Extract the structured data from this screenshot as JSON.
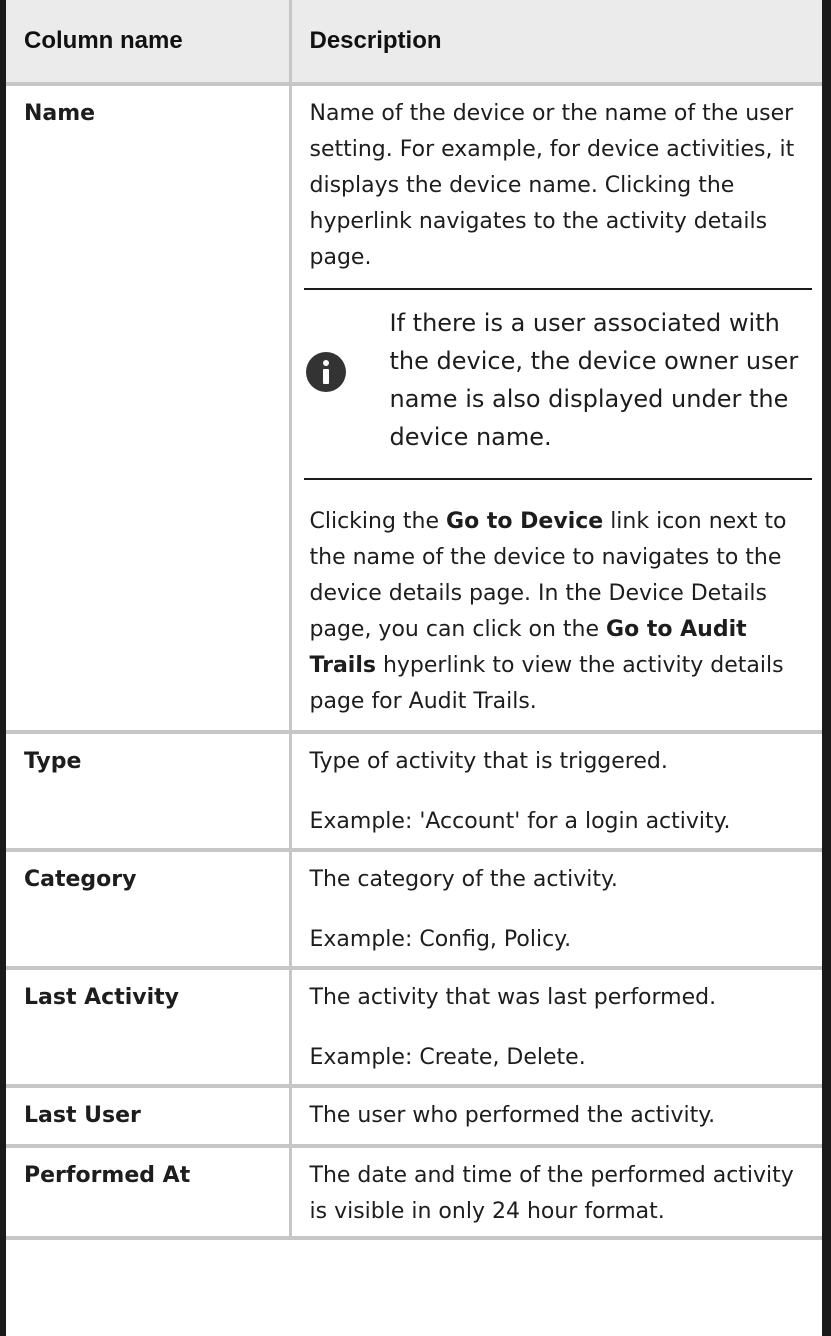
{
  "header": {
    "col1": "Column name",
    "col2": "Description"
  },
  "rows": [
    {
      "name": "Name",
      "desc_1": "Name of the device or the name of the user setting. For example, for device activities, it displays the device name. Clicking the hyperlink navigates to the activity details page.",
      "note": "If there is a user associated with the device, the device owner user name is also displayed under the device name.",
      "desc_2_a": "Clicking the ",
      "desc_2_b": "Go to Device",
      "desc_2_c": " link icon next to the name of the device to navigates to the device details page. In the Device Details page, you can click on the ",
      "desc_2_d": "Go to Audit Trails",
      "desc_2_e": " hyperlink to view the activity details page for Audit Trails."
    },
    {
      "name": "Type",
      "desc_1": "Type of activity that is triggered.",
      "desc_2": "Example: 'Account' for a login activity."
    },
    {
      "name": "Category",
      "desc_1": "The category of the activity.",
      "desc_2": "Example: Config, Policy."
    },
    {
      "name": "Last Activity",
      "desc_1": "The activity that was last performed.",
      "desc_2": "Example: Create, Delete."
    },
    {
      "name": "Last User",
      "desc_1": "The user who performed the activity."
    },
    {
      "name": "Performed At",
      "desc_1": "The date and time of the performed activity is visible in only 24 hour format."
    }
  ],
  "icons": {
    "note": "info-icon"
  },
  "colors": {
    "header_bg": "#ebebeb",
    "row_border": "#c6c6c6",
    "edge": "#1a1a1a",
    "icon": "#333333"
  }
}
